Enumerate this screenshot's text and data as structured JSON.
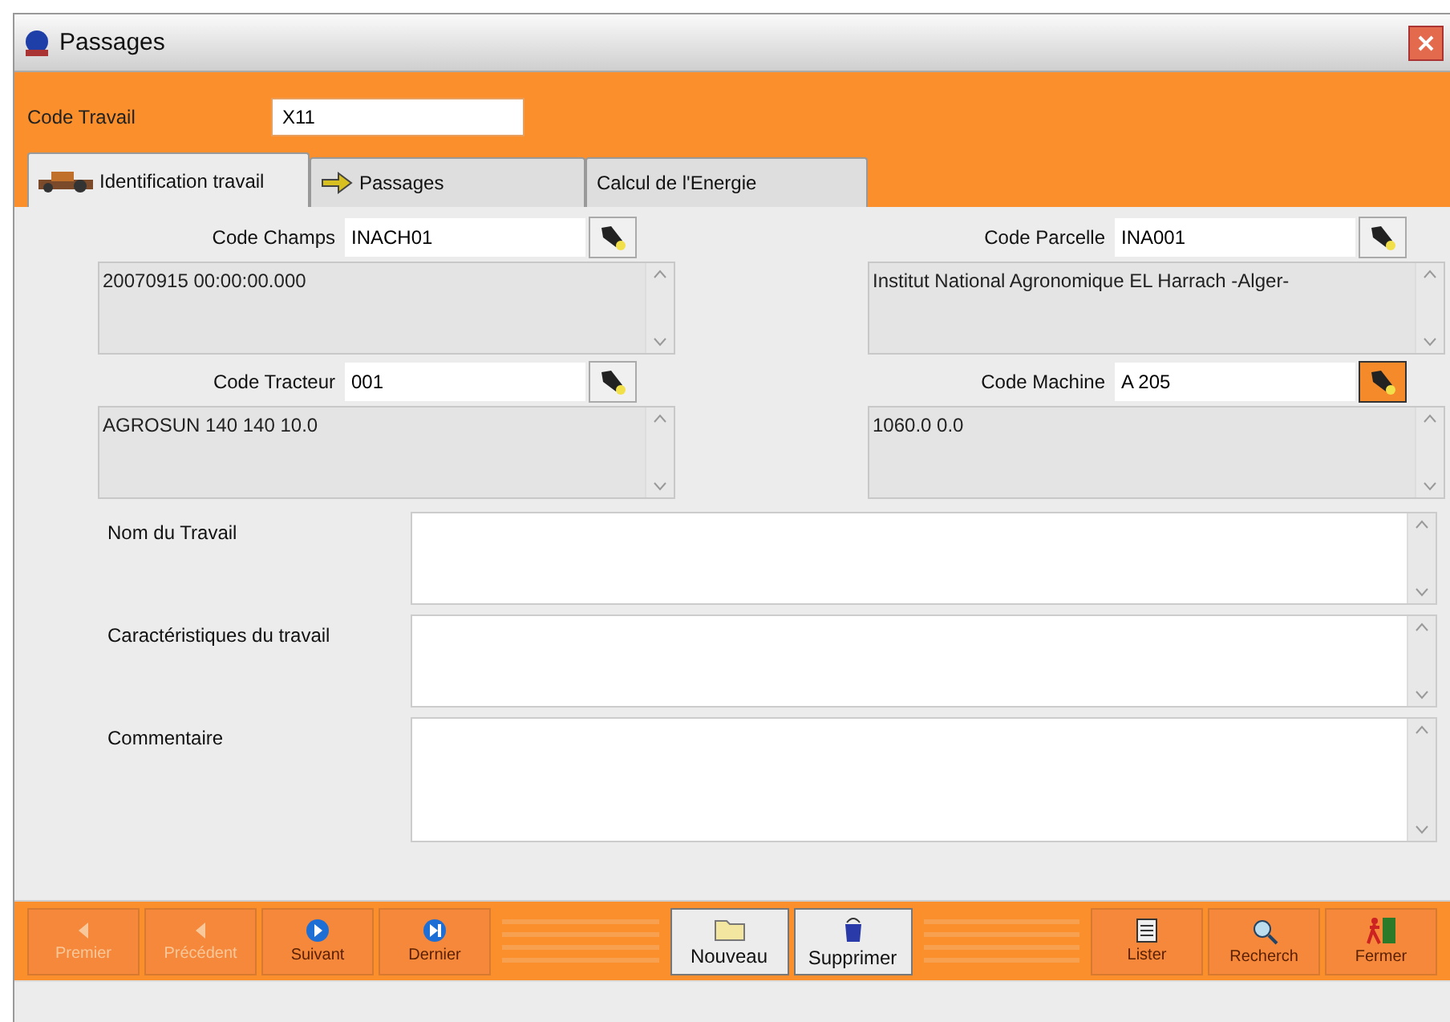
{
  "window": {
    "title": "Passages"
  },
  "code_travail": {
    "label": "Code Travail",
    "value": "X11"
  },
  "tabs": [
    {
      "label": "Identification travail",
      "selected": true
    },
    {
      "label": "Passages",
      "selected": false
    },
    {
      "label": "Calcul de l'Energie",
      "selected": false
    }
  ],
  "lookups": [
    {
      "label": "Code Champs",
      "value": "INACH01",
      "description": "20070915 00:00:00.000",
      "highlighted": false
    },
    {
      "label": "Code Parcelle",
      "value": "INA001",
      "description": "Institut National Agronomique EL Harrach -Alger-",
      "highlighted": false
    },
    {
      "label": "Code Tracteur",
      "value": "001",
      "description": "AGROSUN 140 140 10.0",
      "highlighted": false
    },
    {
      "label": "Code Machine",
      "value": "A 205",
      "description": "1060.0 0.0",
      "highlighted": true
    }
  ],
  "text_areas": [
    {
      "label": "Nom du Travail"
    },
    {
      "label": "Caractéristiques du travail"
    },
    {
      "label": "Commentaire"
    }
  ],
  "buttons": [
    {
      "label": "Premier",
      "kind": "nav",
      "disabled": true
    },
    {
      "label": "Précédent",
      "kind": "nav",
      "disabled": true
    },
    {
      "label": "Suivant",
      "kind": "nav",
      "disabled": false
    },
    {
      "label": "Dernier",
      "kind": "nav",
      "disabled": false
    },
    {
      "label": "Nouveau",
      "kind": "record",
      "disabled": false
    },
    {
      "label": "Supprimer",
      "kind": "record",
      "disabled": false
    },
    {
      "label": "Lister",
      "kind": "tool",
      "disabled": false
    },
    {
      "label": "Recherch",
      "kind": "tool",
      "disabled": false
    },
    {
      "label": "Fermer",
      "kind": "tool",
      "disabled": false
    }
  ]
}
